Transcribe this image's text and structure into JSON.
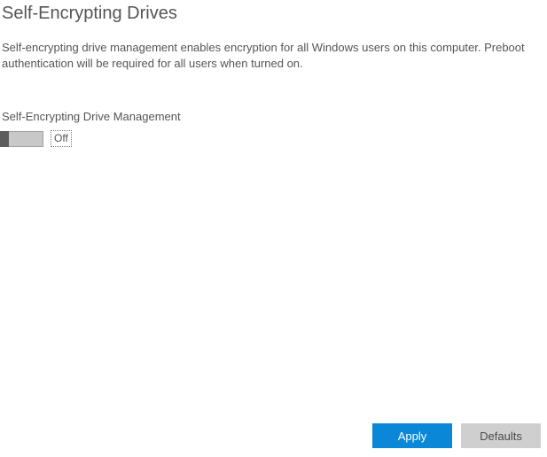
{
  "header": {
    "title": "Self-Encrypting Drives"
  },
  "description": "Self-encrypting drive management enables encryption for all Windows users on this computer. Preboot authentication will be required for all users when turned on.",
  "section": {
    "heading": "Self-Encrypting Drive Management",
    "toggle_state_label": "Off",
    "toggle_on": false
  },
  "buttons": {
    "apply": "Apply",
    "defaults": "Defaults"
  }
}
